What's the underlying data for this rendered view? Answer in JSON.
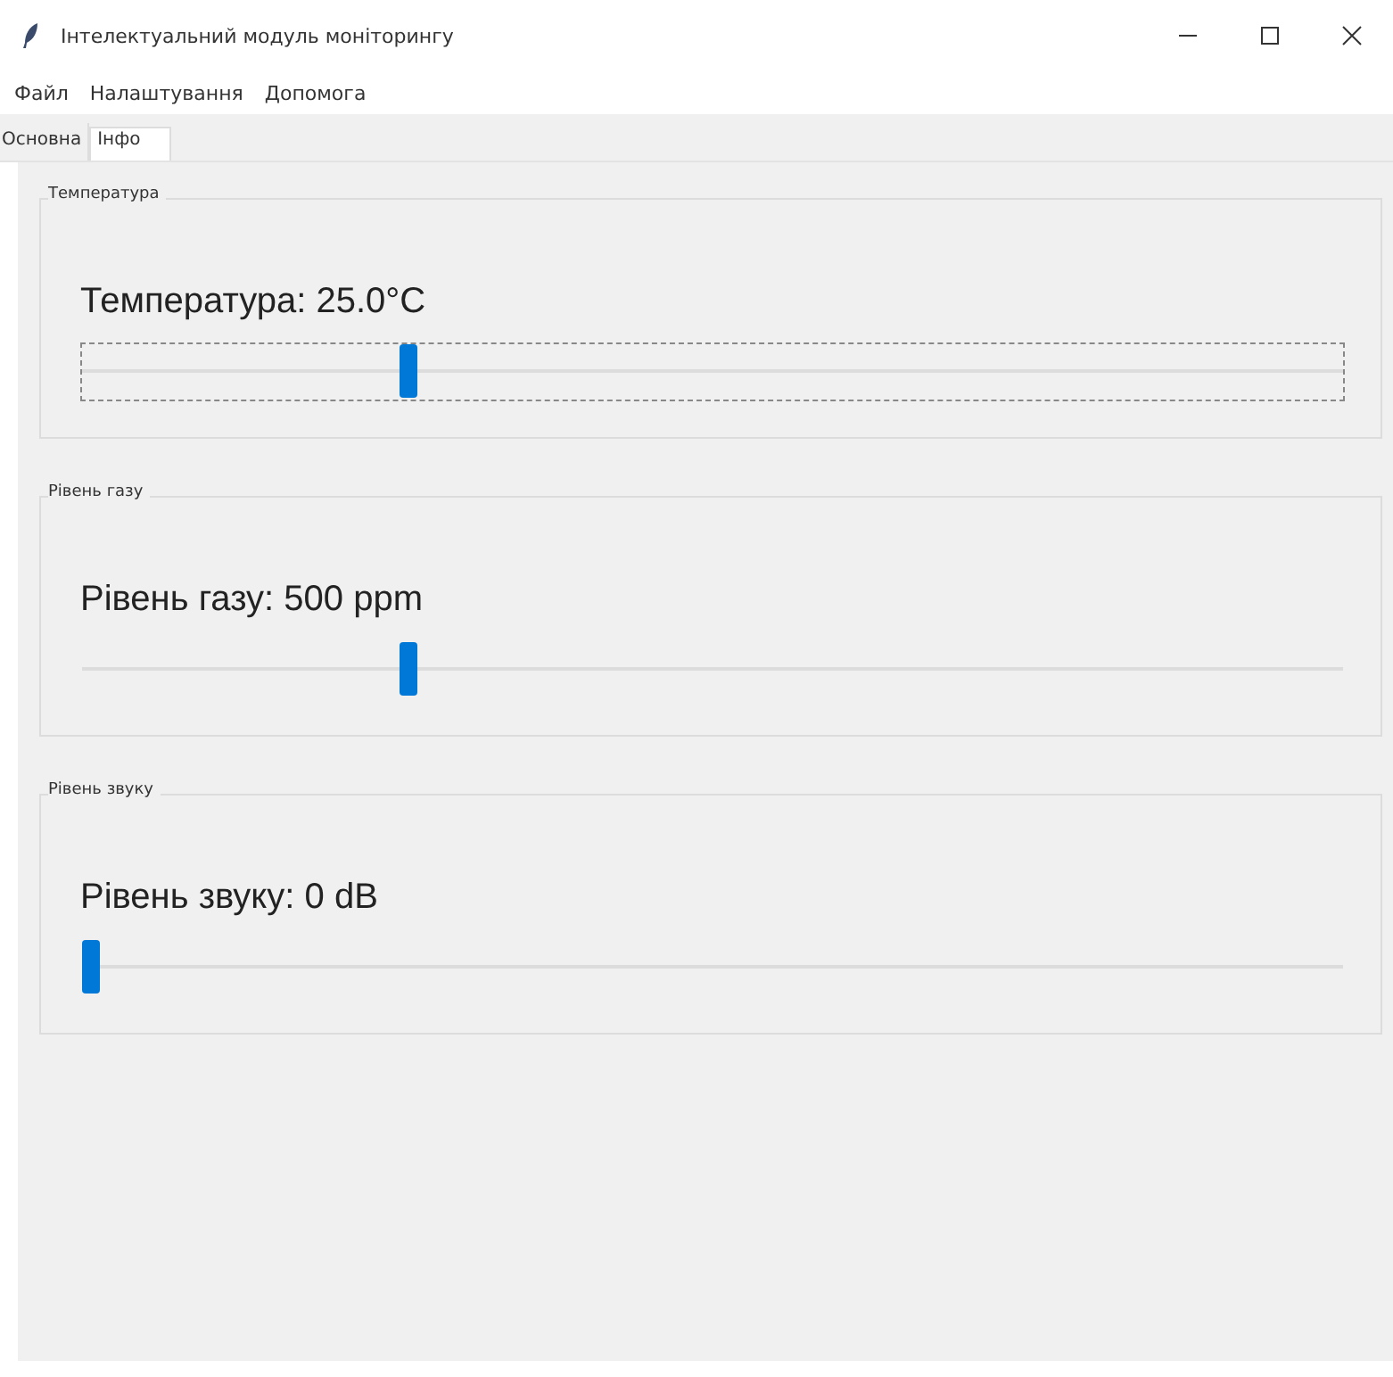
{
  "window": {
    "title": "Інтелектуальний модуль моніторингу"
  },
  "menu": [
    "Файл",
    "Налаштування",
    "Допомога"
  ],
  "tabs": [
    {
      "label": "Основна",
      "selected": false
    },
    {
      "label": "Інфо",
      "selected": true
    }
  ],
  "groups": [
    {
      "title": "Температура",
      "reading": "Температура: 25.0°C",
      "level": 0.255,
      "focused": true
    },
    {
      "title": "Рівень газу",
      "reading": "Рівень газу: 500 ppm",
      "level": 0.255,
      "focused": false
    },
    {
      "title": "Рівень звуку",
      "reading": "Рівень звуку: 0 dB",
      "level": 0,
      "focused": false
    }
  ]
}
